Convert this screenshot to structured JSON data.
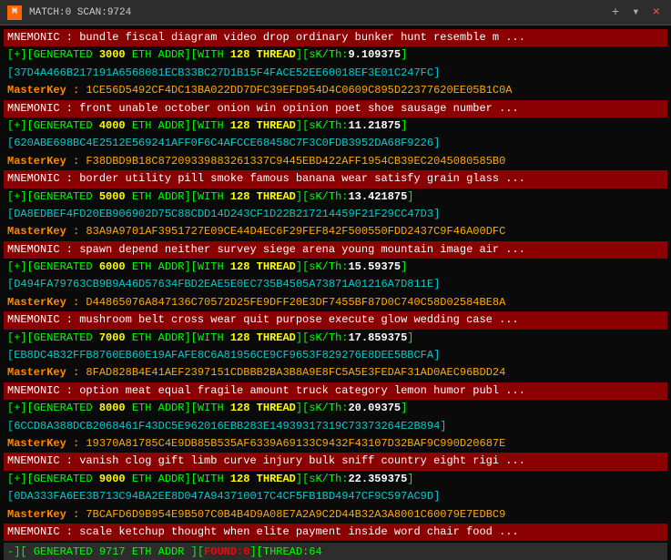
{
  "titlebar": {
    "icon": "M",
    "title": "MATCH:0 SCAN:9724",
    "close": "×",
    "plus": "+",
    "chevron": "▾"
  },
  "rows": [
    {
      "type": "mnemonic",
      "text": "MNEMONIC : bundle fiscal diagram video drop ordinary bunker hunt resemble m ..."
    },
    {
      "type": "generated",
      "prefix": "[+][GENERATED",
      "num": "3000",
      "mid": "ETH ADDR][WITH",
      "thread": "128",
      "sk": "9.109375"
    },
    {
      "type": "addr",
      "text": "37D4A466B217191A6568081ECB33BC27D1B15F4FACE52EE60018EF3E01C247FC"
    },
    {
      "type": "masterkey",
      "label": "MasterKey :",
      "text": "1CE56D5492CF4DC13BA022DD7DFC39EFD954D4C0609C895D22377620EE05B1C0A"
    },
    {
      "type": "mnemonic",
      "text": "MNEMONIC : front unable october onion win opinion poet shoe sausage number ..."
    },
    {
      "type": "generated",
      "prefix": "[+][GENERATED",
      "num": "4000",
      "mid": "ETH ADDR][WITH",
      "thread": "128",
      "sk": "11.21875"
    },
    {
      "type": "addr",
      "text": "620ABE698BC4E2512E569241AFF0F6C4AFCCE68458C7F3C0FDB3952DA68F9226"
    },
    {
      "type": "masterkey",
      "label": "MasterKey :",
      "text": "F38DBD9B18C87209339883261337C9445EBD422AFF1954CB39EC2045080585B0"
    },
    {
      "type": "mnemonic",
      "text": "MNEMONIC : border utility pill smoke famous banana wear satisfy grain glass ..."
    },
    {
      "type": "generated",
      "prefix": "[+][GENERATED",
      "num": "5000",
      "mid": "ETH ADDR][WITH",
      "thread": "128",
      "sk": "13.421875"
    },
    {
      "type": "addr",
      "text": "DA8EDBEF4FD20EB906902D75C88CDD14D243CF1D22B217214459F21F29CC47D3"
    },
    {
      "type": "masterkey",
      "label": "MasterKey :",
      "text": "83A9A9701AF3951727E09CE44D4EC6F29FEF842F500550FDD2437C9F46A00DFC"
    },
    {
      "type": "mnemonic",
      "text": "MNEMONIC : spawn depend neither survey siege arena young mountain image air ..."
    },
    {
      "type": "generated",
      "prefix": "[+][GENERATED",
      "num": "6000",
      "mid": "ETH ADDR][WITH",
      "thread": "128",
      "sk": "15.59375"
    },
    {
      "type": "addr",
      "text": "D494FA79763CB9B9A46D57634FBD2EAE5E0EC735B4505A73871A01216A7D811E"
    },
    {
      "type": "masterkey",
      "label": "MasterKey :",
      "text": "D44865076A847136C70572D25FE9DFF20E3DF7455BF87D0C740C58D02584BE8A"
    },
    {
      "type": "mnemonic",
      "text": "MNEMONIC : mushroom belt cross wear quit purpose execute glow wedding case ..."
    },
    {
      "type": "generated",
      "prefix": "[+][GENERATED",
      "num": "7000",
      "mid": "ETH ADDR][WITH",
      "thread": "128",
      "sk": "17.859375"
    },
    {
      "type": "addr",
      "text": "EB8DC4B32FFB8760EB60E19AFAFE8C6A81956CE9CF9653F829276E8DEE5BBCFA"
    },
    {
      "type": "masterkey",
      "label": "MasterKey :",
      "text": "8FAD828B4E41AEF2397151CDBBB2BA3B8A9E8FC5A5E3FEDAF31AD0AEC96BDD24"
    },
    {
      "type": "mnemonic",
      "text": "MNEMONIC : option meat equal fragile amount truck category lemon humor publ ..."
    },
    {
      "type": "generated",
      "prefix": "[+][GENERATED",
      "num": "8000",
      "mid": "ETH ADDR][WITH",
      "thread": "128",
      "sk": "20.09375"
    },
    {
      "type": "addr",
      "text": "6CCD8A388DCB2068461F43DC5E962016EBB283E14939317319C73373264E2B894"
    },
    {
      "type": "masterkey",
      "label": "MasterKey :",
      "text": "19370A81785C4E9DB85B535AF6339A69133C9432F43107D32BAF9C990D20687E"
    },
    {
      "type": "mnemonic",
      "text": "MNEMONIC : vanish clog gift limb curve injury bulk sniff country eight rigi ..."
    },
    {
      "type": "generated",
      "prefix": "[+][GENERATED",
      "num": "9000",
      "mid": "ETH ADDR][WITH",
      "thread": "128",
      "sk": "22.359375"
    },
    {
      "type": "addr",
      "text": "0DA333FA6EE3B713C94BA2EE8D047A943710017C4CF5FB1BD4947CF9C597AC9D"
    },
    {
      "type": "masterkey",
      "label": "MasterKey :",
      "text": "7BCAFD6D9B954E9B507C0B4B4D9A08E7A2A9C2D44B32A3A8001C60079E7EDBC9"
    },
    {
      "type": "mnemonic",
      "text": "MNEMONIC : scale ketchup thought when elite payment inside word chair food ..."
    },
    {
      "type": "status",
      "text": "-][ GENERATED 9717 ETH ADDR ][FOUND:0][THREAD:64"
    }
  ]
}
